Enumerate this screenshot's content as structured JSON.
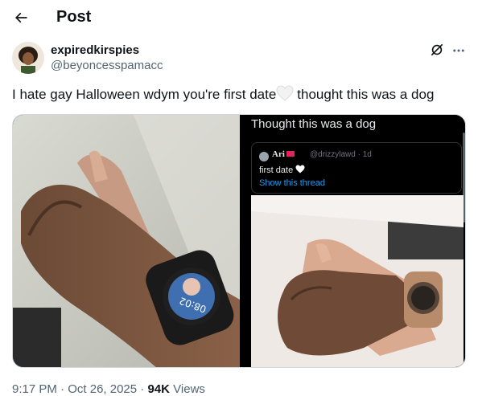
{
  "header": {
    "title": "Post",
    "back_icon": "arrow-left-icon"
  },
  "author": {
    "display_name": "expiredkirspies",
    "handle": "@beyoncesspamacc",
    "grok_icon": "grok-icon",
    "more_icon": "more-horizontal-icon"
  },
  "tweet": {
    "text_before_heart": "I hate gay Halloween wdym you're first date",
    "heart_icon": "white-heart-emoji",
    "text_after_heart": "thought this was a dog"
  },
  "media": {
    "right_caption": "Thought this was a dog",
    "quote": {
      "name": "Ari",
      "handle_time": "@drizzylawd · 1d",
      "text": "first date",
      "link": "Show this thread"
    }
  },
  "meta": {
    "time": "9:17 PM",
    "date": "Oct 26, 2025",
    "views_count": "94K",
    "views_label": "Views"
  },
  "colors": {
    "text": "#0f1419",
    "secondary": "#536471",
    "link": "#1d9bf0",
    "border": "#cfd9de"
  }
}
